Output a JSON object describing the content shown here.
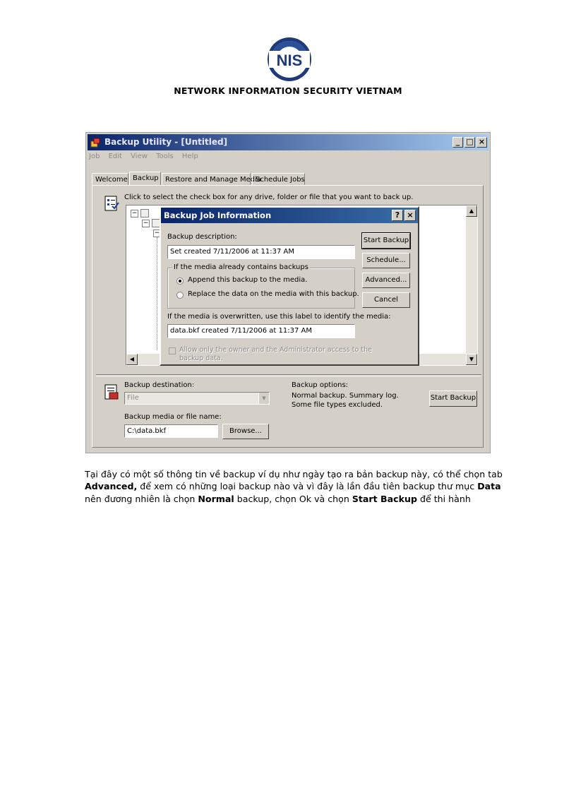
{
  "header": {
    "logo_text": "NIS",
    "organization": "NETWORK INFORMATION SECURITY VIETNAM"
  },
  "window": {
    "title": "Backup Utility - [Untitled]",
    "menu": [
      "Job",
      "Edit",
      "View",
      "Tools",
      "Help"
    ],
    "tabs": [
      "Welcome",
      "Backup",
      "Restore and Manage Media",
      "Schedule Jobs"
    ],
    "active_tab": "Backup",
    "hint": "Click to select the check box for any drive, folder or file that you want to back up.",
    "backup_destination_label": "Backup destination:",
    "backup_destination_value": "File",
    "backup_media_label": "Backup media or file name:",
    "backup_media_value": "C:\\data.bkf",
    "browse_button": "Browse...",
    "backup_options_label": "Backup options:",
    "backup_options_line1": "Normal backup.  Summary log.",
    "backup_options_line2": "Some file types excluded.",
    "start_backup_button": "Start Backup"
  },
  "dialog": {
    "title": "Backup Job Information",
    "description_label": "Backup description:",
    "description_value": "Set created 7/11/2006 at 11:37 AM",
    "group_label": "If the media already contains backups",
    "radio_append": "Append this backup to the media.",
    "radio_replace": "Replace the data on the media with this backup.",
    "selected_option": "append",
    "overwrite_label": "If the media is overwritten, use this label to identify the media:",
    "overwrite_value": "data.bkf created 7/11/2006 at 11:37 AM",
    "allow_owner_line1": "Allow only the owner and the Administrator access to the",
    "allow_owner_line2": "backup data.",
    "buttons": {
      "start_backup": "Start Backup",
      "schedule": "Schedule...",
      "advanced": "Advanced...",
      "cancel": "Cancel"
    }
  },
  "body_text": {
    "p1": "Tại đây có một số thông tin về backup ví dụ như ngày tạo ra bản backup này, có thể chọn tab ",
    "b1": "Advanced,",
    "p2": " để xem có những loại backup nào và vì đây là lần đầu tiên backup thư mục ",
    "b2": "Data",
    "p3": " nên đương nhiên là chọn ",
    "b3": "Normal",
    "p4": " backup, chọn Ok và chọn ",
    "b4": "Start Backup",
    "p5": " để thi hành"
  },
  "colors": {
    "titlebar_start": "#0a246a",
    "titlebar_end": "#a6caf0",
    "window_face": "#d4d0c8",
    "logo_blue": "#1f3a7a"
  }
}
